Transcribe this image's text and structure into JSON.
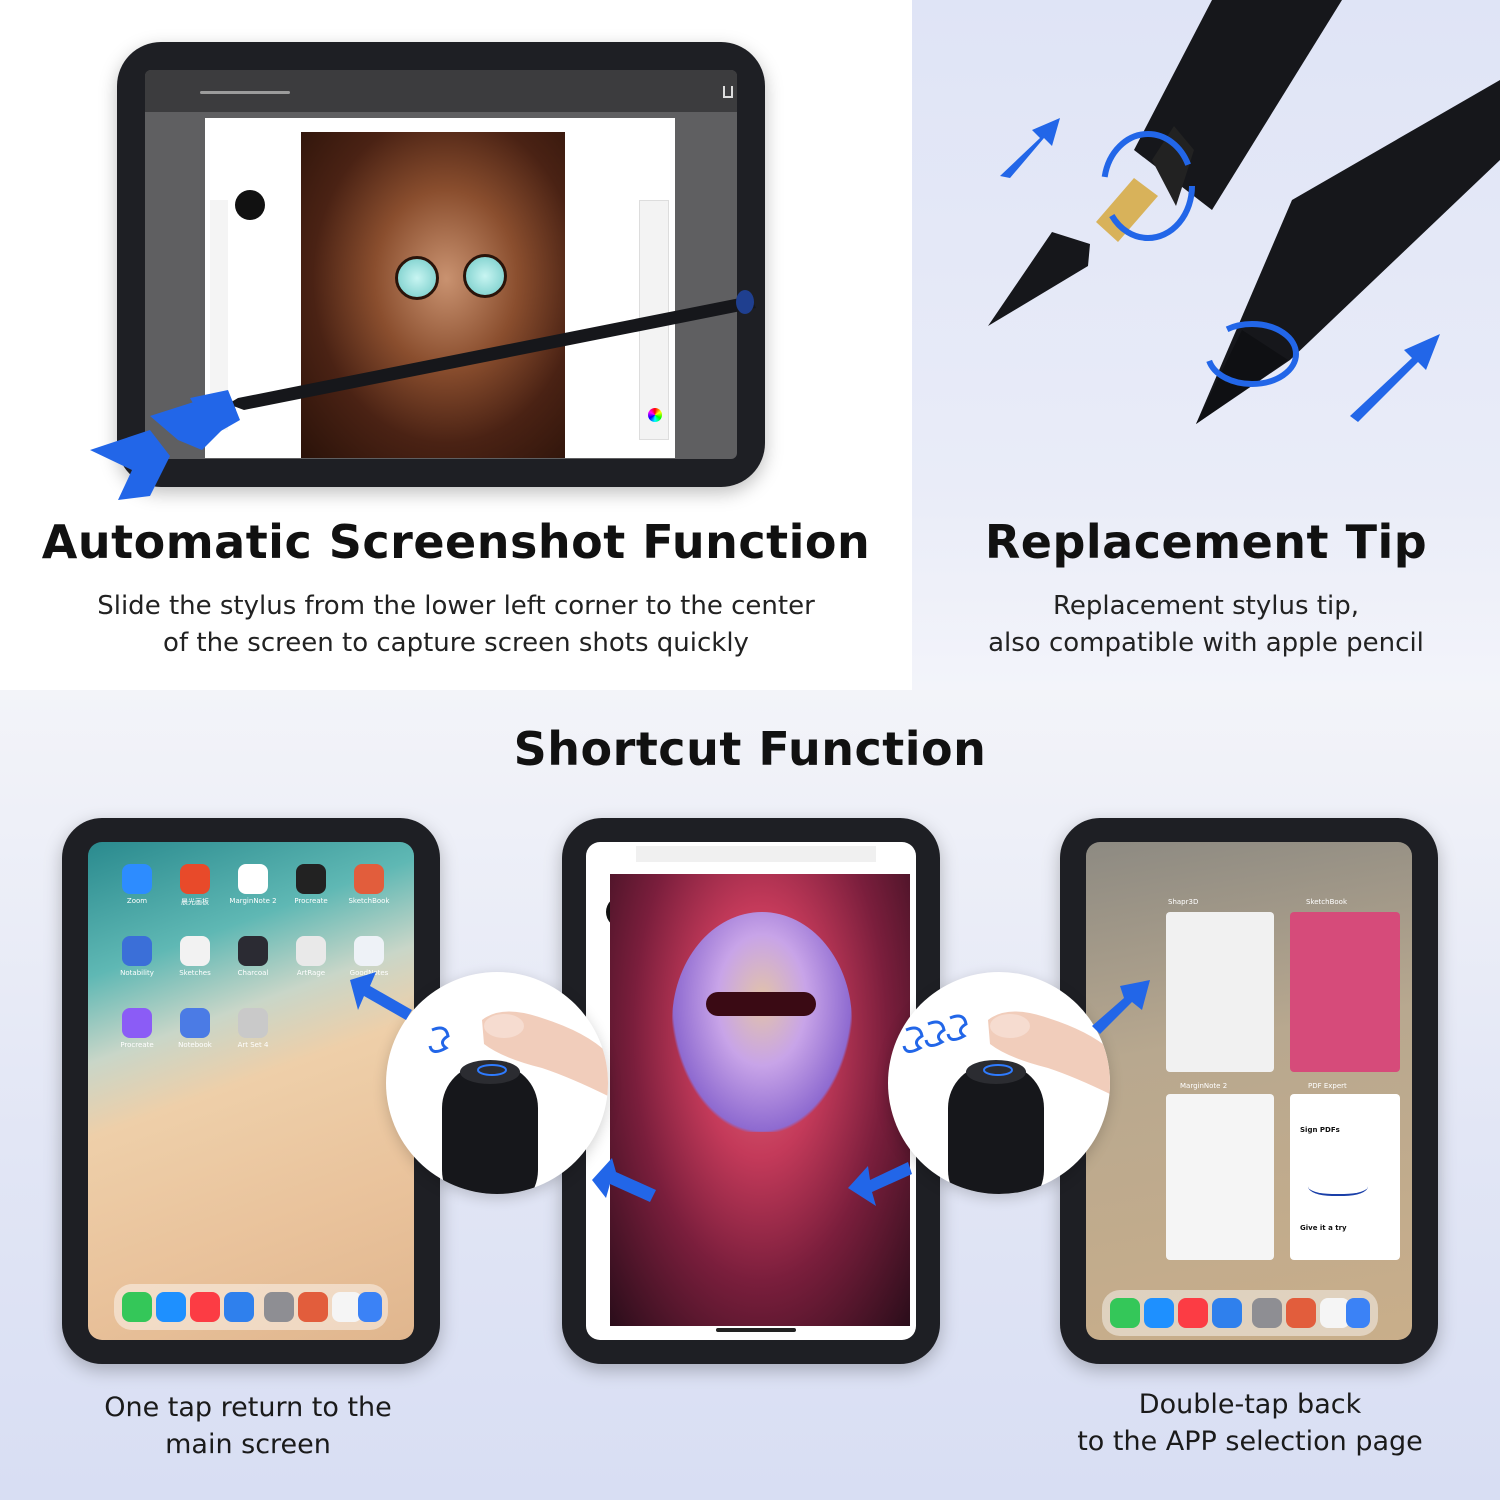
{
  "screenshot_panel": {
    "title": "Automatic Screenshot Function",
    "subtitle_line1": "Slide the stylus from the lower left corner to the center",
    "subtitle_line2": "of the screen to capture screen shots quickly"
  },
  "tip_panel": {
    "title": "Replacement Tip",
    "subtitle_line1": "Replacement stylus tip,",
    "subtitle_line2": "also compatible with apple pencil"
  },
  "shortcut_panel": {
    "title": "Shortcut Function",
    "left_caption_line1": "One tap return to the",
    "left_caption_line2": "main screen",
    "right_caption_line1": "Double-tap back",
    "right_caption_line2": "to the APP selection page"
  },
  "home_apps": [
    {
      "label": "Zoom",
      "color": "#2d8cff"
    },
    {
      "label": "晨光画板",
      "color": "#e84a2a"
    },
    {
      "label": "MarginNote 2",
      "color": "#ffffff"
    },
    {
      "label": "Procreate",
      "color": "#222222"
    },
    {
      "label": "SketchBook",
      "color": "#e25d3c"
    },
    {
      "label": "Notability",
      "color": "#3b6fd8"
    },
    {
      "label": "Sketches",
      "color": "#f2f2f2"
    },
    {
      "label": "Charcoal",
      "color": "#2b2b33"
    },
    {
      "label": "ArtRage",
      "color": "#e9e9e9"
    },
    {
      "label": "GoodNotes",
      "color": "#eef2f7"
    },
    {
      "label": "Procreate",
      "color": "#8b5cf6"
    },
    {
      "label": "Notebook",
      "color": "#4b7be5"
    },
    {
      "label": "Art Set 4",
      "color": "#c9c9c9"
    }
  ],
  "switcher_apps": [
    {
      "label": "Shapr3D"
    },
    {
      "label": "SketchBook"
    },
    {
      "label": "MarginNote 2"
    },
    {
      "label": "PDF Expert"
    }
  ],
  "pdf_card": {
    "heading": "Sign PDFs",
    "footer": "Give it a try"
  },
  "colors": {
    "accent_blue": "#2266e8",
    "pen_black": "#16171b",
    "tablet_frame": "#1e1f24"
  }
}
